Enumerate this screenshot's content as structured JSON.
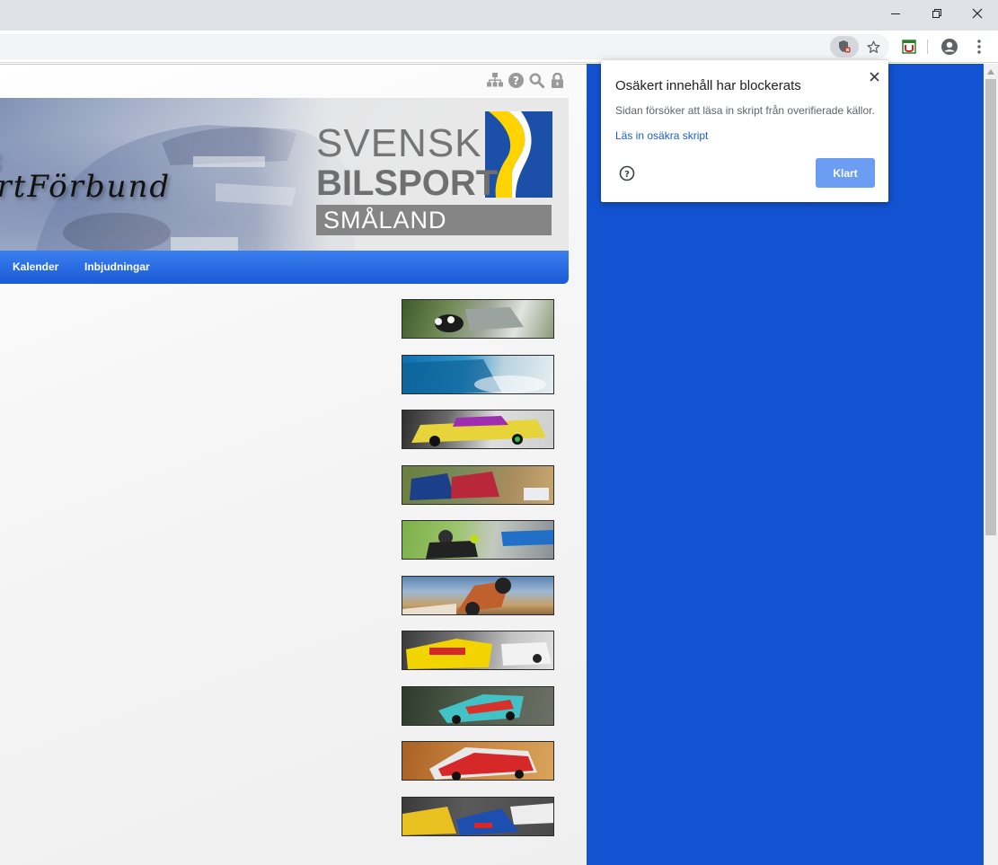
{
  "colors": {
    "accent_blue": "#1353d2",
    "nav_blue": "#1a5bd6",
    "button_blue": "#6b9df3",
    "link_blue": "#1a5fc8",
    "logo_yellow": "#ffd400",
    "logo_blue": "#1c4fa8"
  },
  "window": {
    "minimize_icon": "minimize-icon",
    "restore_icon": "restore-icon",
    "close_icon": "close-icon"
  },
  "toolbar": {
    "icons": [
      "blocked-content-shield-icon",
      "bookmark-star-icon",
      "extension-icon",
      "profile-avatar-icon",
      "menu-kebab-icon"
    ]
  },
  "page": {
    "top_icons": [
      "sitemap-icon",
      "help-icon",
      "search-icon",
      "lock-icon"
    ],
    "banner": {
      "title_line1": "ds",
      "title_line2": "ortFörbund",
      "logo_line1": "SVENSK",
      "logo_line2": "BILSPORT",
      "logo_region": "SMÅLAND"
    },
    "nav": {
      "items": [
        "Kalender",
        "Inbjudningar"
      ]
    },
    "thumbnails": [
      "rally-thumbnail",
      "drift-thumbnail",
      "drift-race-thumbnail",
      "rallycross-thumbnail",
      "karting-thumbnail",
      "offroad-thumbnail",
      "touring-car-thumbnail",
      "racing-car-thumbnail",
      "rally-car-thumbnail",
      "rallycross-group-thumbnail"
    ]
  },
  "popup": {
    "title": "Osäkert innehåll har blockerats",
    "description": "Sidan försöker att läsa in skript från overifierade källor.",
    "link": "Läs in osäkra skript",
    "done_button": "Klart"
  }
}
